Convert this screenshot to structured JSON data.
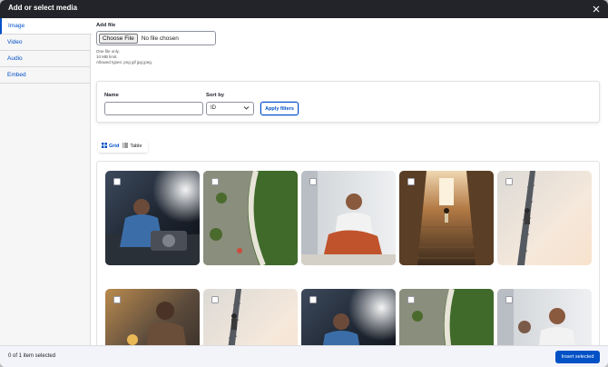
{
  "dialog": {
    "title": "Add or select media",
    "close_icon": "close-icon"
  },
  "sidebar": {
    "items": [
      {
        "label": "Image",
        "active": true
      },
      {
        "label": "Video",
        "active": false
      },
      {
        "label": "Audio",
        "active": false
      },
      {
        "label": "Embed",
        "active": false
      }
    ]
  },
  "upload": {
    "label": "Add file",
    "button_label": "Choose File",
    "no_file_text": "No file chosen",
    "desc_line1": "One file only.",
    "desc_line2": "10 MB limit.",
    "desc_line3": "Allowed types: png gif jpg jpeg."
  },
  "filters": {
    "name_label": "Name",
    "name_value": "",
    "sort_label": "Sort by",
    "sort_value": "ID",
    "apply_label": "Apply filters"
  },
  "view_tabs": {
    "grid_label": "Grid",
    "table_label": "Table",
    "active": "grid"
  },
  "media": {
    "items": [
      {
        "subject": "machinist",
        "checkbox": true
      },
      {
        "subject": "aerial-plaza",
        "checkbox": true
      },
      {
        "subject": "tailor",
        "checkbox": true
      },
      {
        "subject": "stairs-runner",
        "checkbox": true
      },
      {
        "subject": "tower-climber",
        "checkbox": true
      },
      {
        "subject": "welder",
        "checkbox": true
      },
      {
        "subject": "tower-climber",
        "checkbox": true
      },
      {
        "subject": "machinist",
        "checkbox": true
      },
      {
        "subject": "aerial-plaza",
        "checkbox": true
      },
      {
        "subject": "tailor",
        "checkbox": true
      }
    ]
  },
  "footer": {
    "status": "0 of 1 item selected",
    "insert_label": "Insert selected"
  },
  "colors": {
    "accent": "#0050c6",
    "titlebar": "#232429"
  }
}
